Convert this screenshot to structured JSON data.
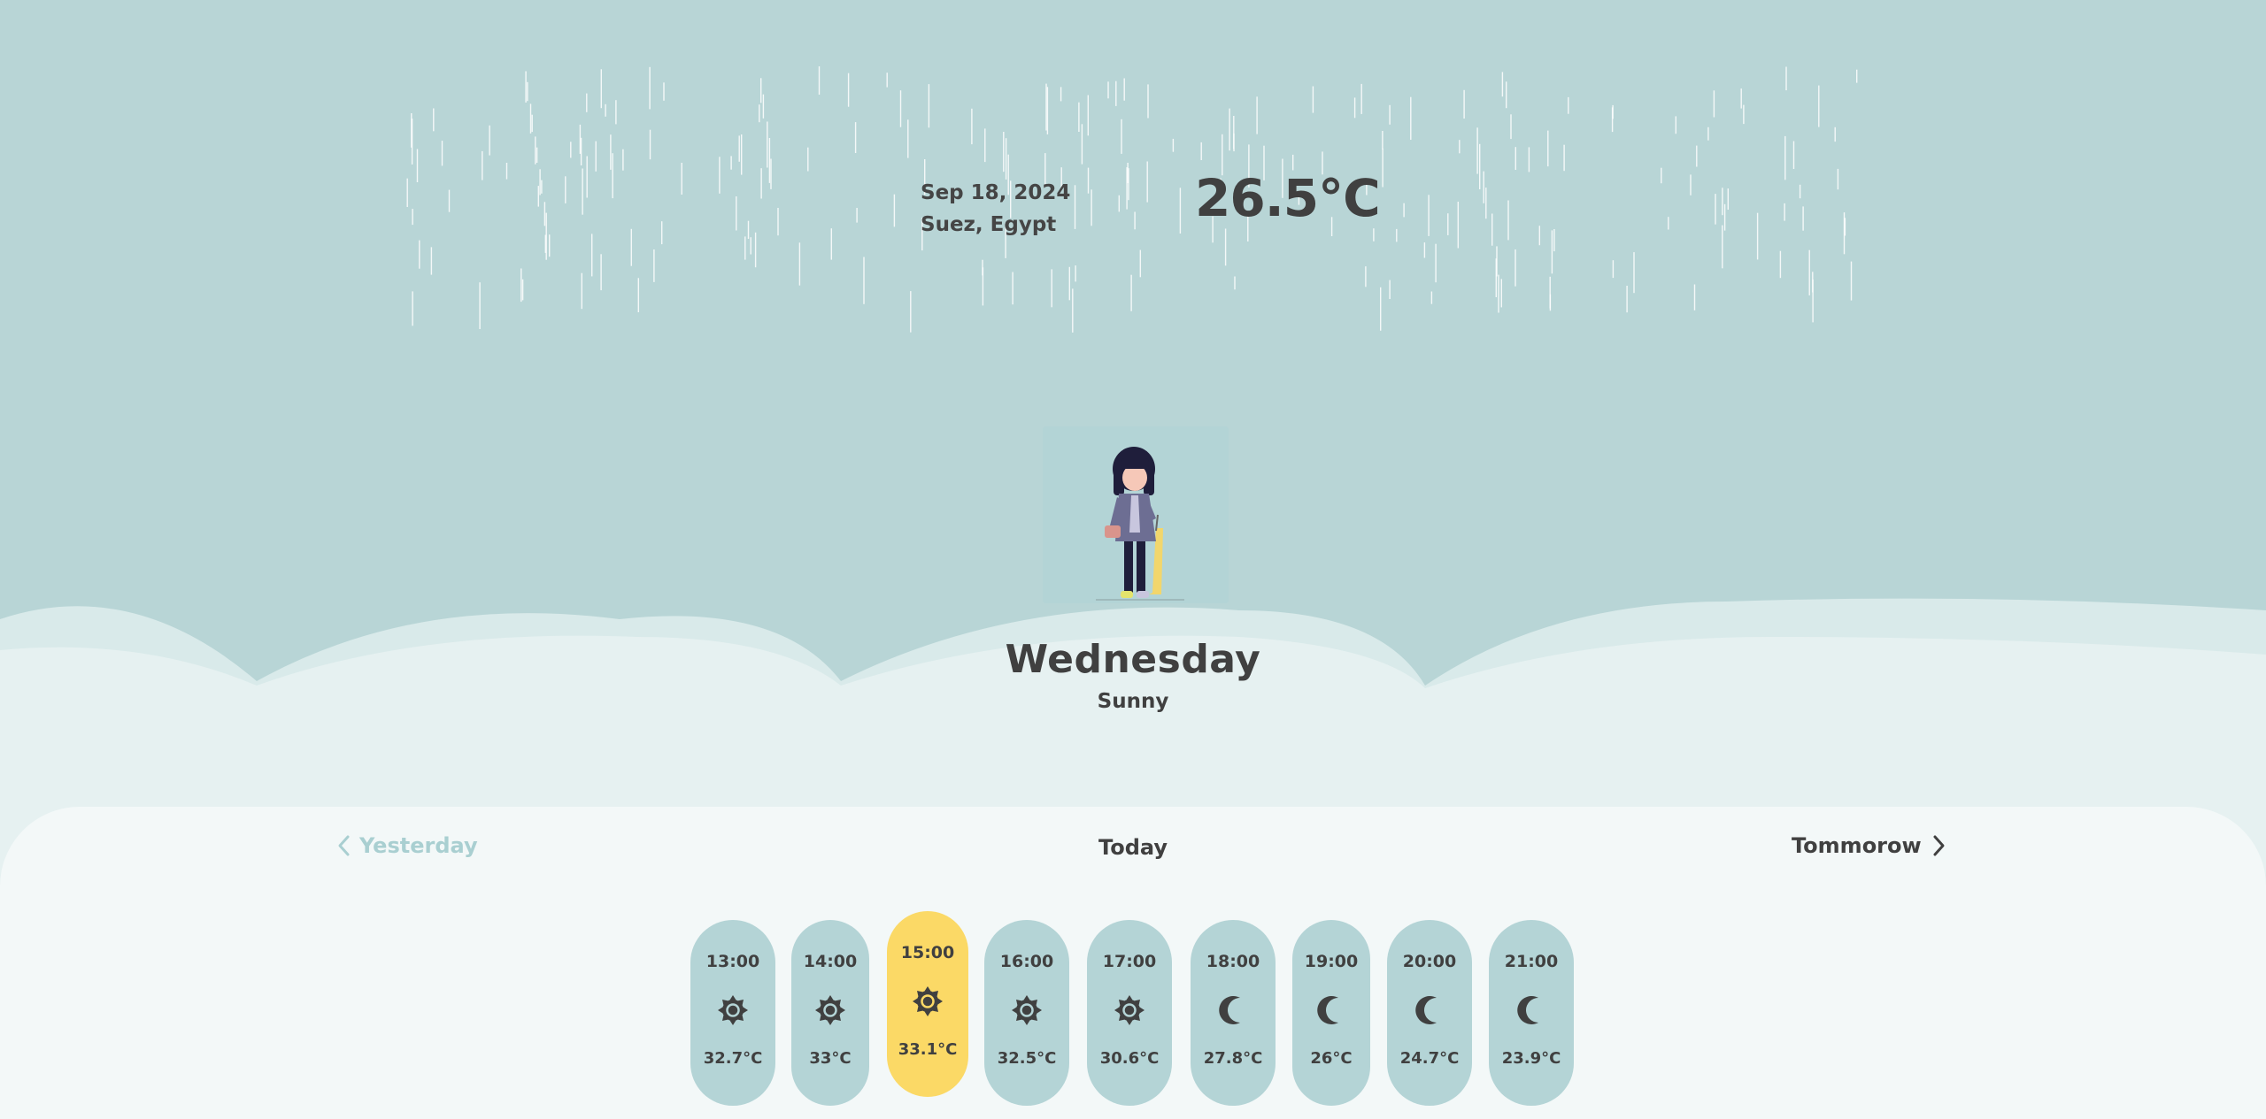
{
  "header": {
    "date": "Sep 18, 2024",
    "location": "Suez, Egypt",
    "temperature": "26.5°C"
  },
  "day": {
    "name": "Wednesday",
    "condition": "Sunny"
  },
  "nav": {
    "prev_label": "Yesterday",
    "current_label": "Today",
    "next_label": "Tommorow"
  },
  "hourly": [
    {
      "time": "13:00",
      "icon": "sun-icon",
      "temp": "32.7°C",
      "active": false
    },
    {
      "time": "14:00",
      "icon": "sun-icon",
      "temp": "33°C",
      "active": false
    },
    {
      "time": "15:00",
      "icon": "sun-icon",
      "temp": "33.1°C",
      "active": true
    },
    {
      "time": "16:00",
      "icon": "sun-icon",
      "temp": "32.5°C",
      "active": false
    },
    {
      "time": "17:00",
      "icon": "sun-icon",
      "temp": "30.6°C",
      "active": false
    },
    {
      "time": "18:00",
      "icon": "moon-icon",
      "temp": "27.8°C",
      "active": false
    },
    {
      "time": "19:00",
      "icon": "moon-icon",
      "temp": "26°C",
      "active": false
    },
    {
      "time": "20:00",
      "icon": "moon-icon",
      "temp": "24.7°C",
      "active": false
    },
    {
      "time": "21:00",
      "icon": "moon-icon",
      "temp": "23.9°C",
      "active": false
    }
  ],
  "colors": {
    "sky": "#b8d5d6",
    "panel": "#f3f8f8",
    "pill": "#b4d4d6",
    "pill_active": "#fbd966",
    "text": "#404040",
    "muted": "#a9cfd1"
  }
}
